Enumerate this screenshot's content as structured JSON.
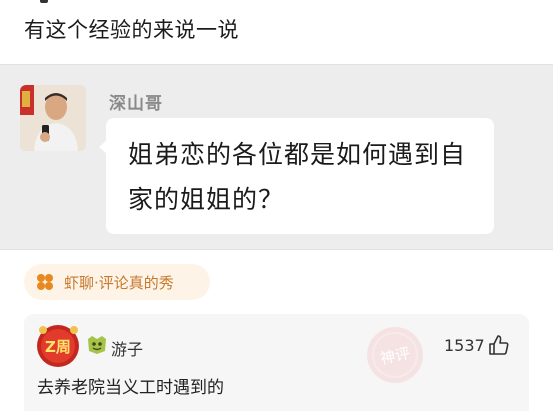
{
  "post": {
    "title": "有这个经验的来说一说"
  },
  "quoted_message": {
    "sender": "深山哥",
    "text": "姐弟恋的各位都是如何遇到自家的姐姐的？"
  },
  "tag": {
    "label": "虾聊·评论真的秀",
    "accent_color": "#e8891f"
  },
  "comment": {
    "avatar_text": "Z周",
    "username": "游子",
    "likes": "1537",
    "stamp_text": "神评",
    "text": "去养老院当义工时遇到的"
  }
}
